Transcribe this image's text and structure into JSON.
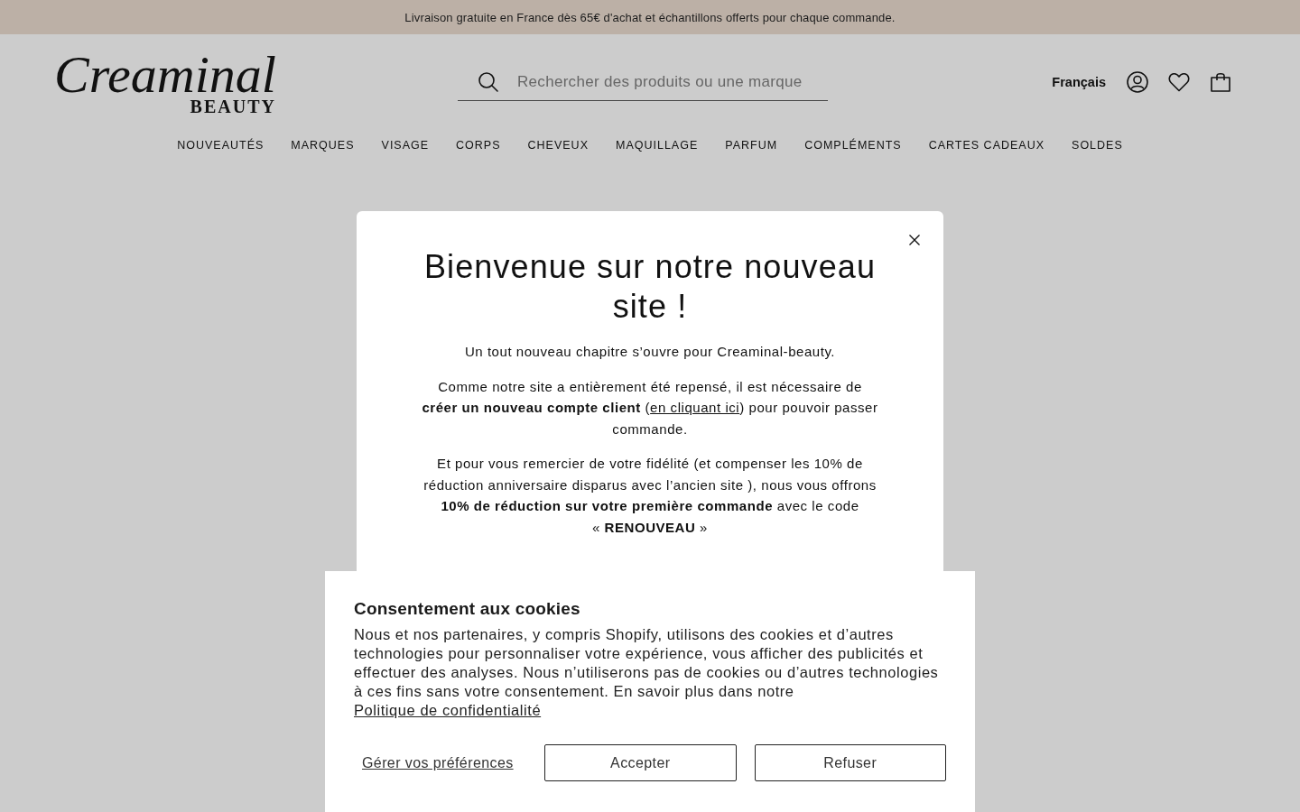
{
  "announcement": "Livraison gratuite en France dès 65€ d'achat et échantillons offerts pour chaque commande.",
  "header": {
    "logo": {
      "script": "Creaminal",
      "subtitle": "BEAUTY"
    },
    "search": {
      "placeholder": "Rechercher des produits ou une marque"
    },
    "language": "Français"
  },
  "nav": [
    "NOUVEAUTÉS",
    "MARQUES",
    "VISAGE",
    "CORPS",
    "CHEVEUX",
    "MAQUILLAGE",
    "PARFUM",
    "COMPLÉMENTS",
    "CARTES CADEAUX",
    "SOLDES"
  ],
  "modal": {
    "title": "Bienvenue sur notre nouveau site !",
    "paragraphs": [
      {
        "text": "Un tout nouveau chapitre s’ouvre pour Creaminal-beauty."
      },
      {
        "text": "Comme notre site a entièrement été repensé, il est nécessaire de **créer un nouveau compte client** (",
        "link": "en cliquant ici",
        "after": ") pour pouvoir passer commande."
      },
      {
        "text": "Et pour vous remercier de votre fidélité (et compenser les 10% de réduction anniversaire disparus avec l’ancien site ), nous vous offrons **10% de réduction sur votre première commande** avec le code « **RENOUVEAU** »"
      }
    ]
  },
  "cookie_banner": {
    "title": "Consentement aux cookies",
    "text": "Nous et nos partenaires, y compris Shopify, utilisons des cookies et d’autres technologies pour personnaliser votre expérience, vous afficher des publicités et effectuer des analyses. Nous n’utiliserons pas de cookies ou d’autres technologies à ces fins sans votre consentement. En savoir plus dans notre ",
    "link": "Politique de confidentialité",
    "preferences": "Gérer vos préférences",
    "buttons": [
      "Accepter",
      "Refuser"
    ]
  }
}
